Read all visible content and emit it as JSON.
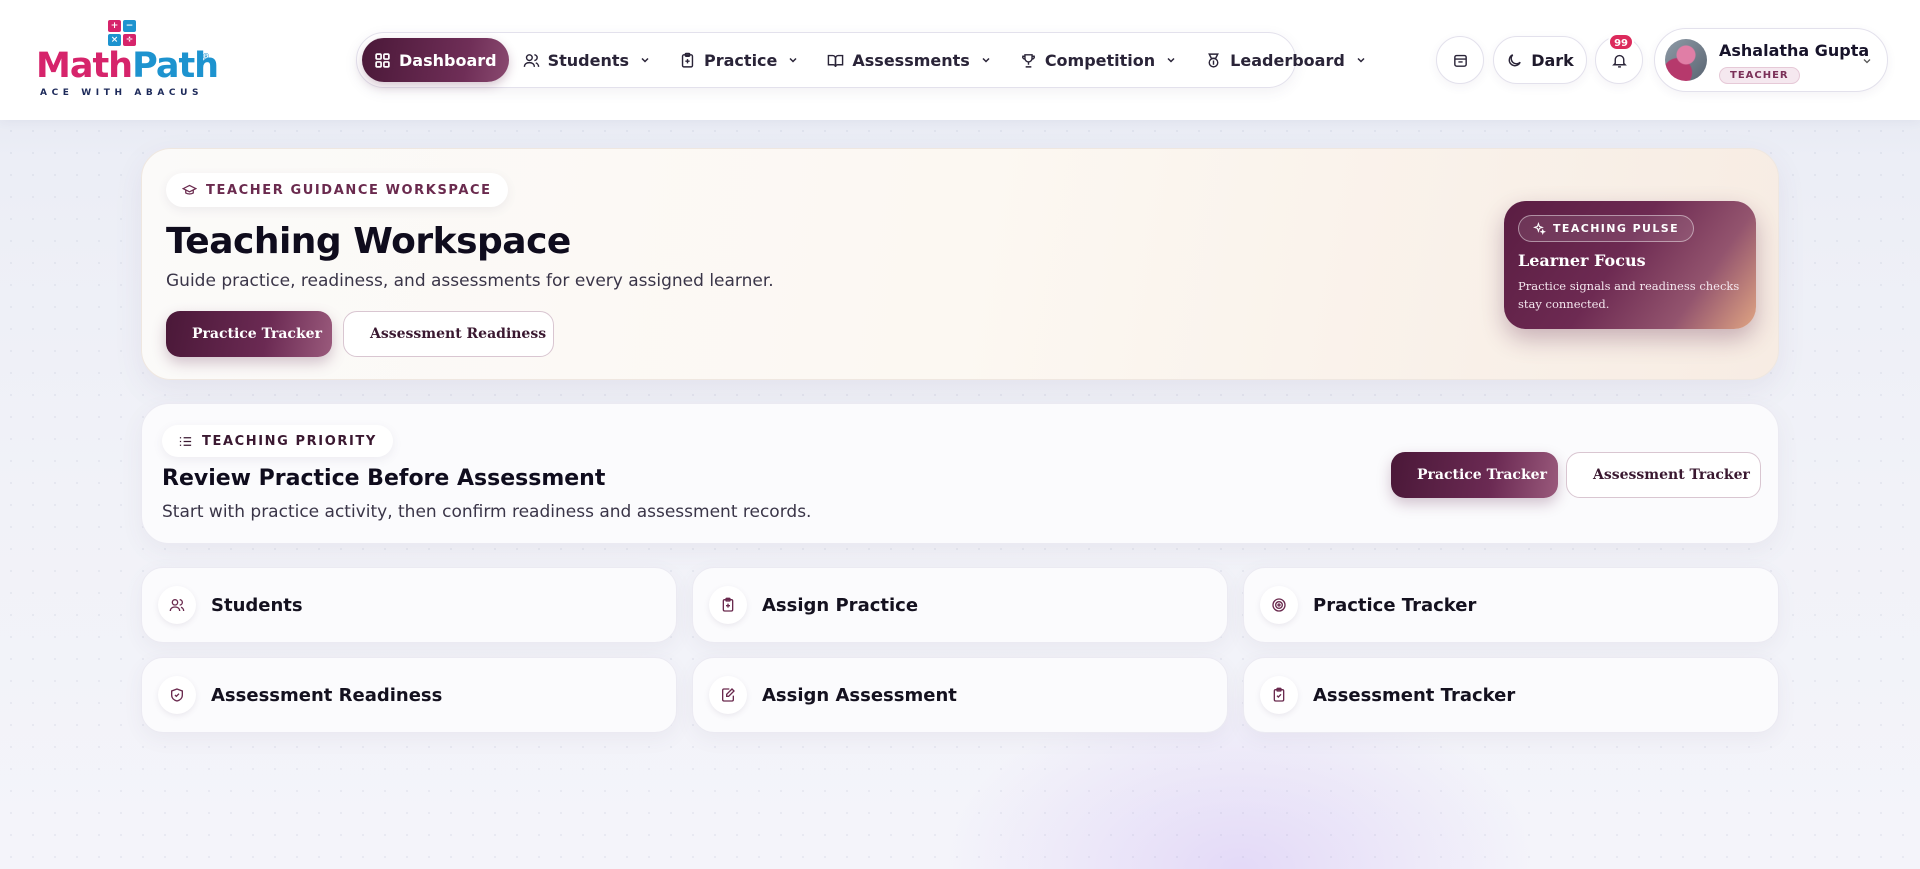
{
  "brand": {
    "name_part1": "Math",
    "name_part2": "Path",
    "tagline": "ACE WITH ABACUS",
    "colors": {
      "pink": "#d6246b",
      "blue": "#1d93cf",
      "navy": "#1d2a5a"
    }
  },
  "nav": {
    "items": [
      {
        "label": "Dashboard",
        "icon": "dashboard-grid-icon",
        "active": true
      },
      {
        "label": "Students",
        "icon": "users-icon"
      },
      {
        "label": "Practice",
        "icon": "clipboard-plus-icon"
      },
      {
        "label": "Assessments",
        "icon": "open-book-icon"
      },
      {
        "label": "Competition",
        "icon": "trophy-icon"
      },
      {
        "label": "Leaderboard",
        "icon": "award-medal-icon"
      }
    ]
  },
  "header": {
    "theme_label": "Dark",
    "notification_count": "99",
    "user_name": "Ashalatha Gupta",
    "user_role": "TEACHER"
  },
  "hero": {
    "eyebrow": "TEACHER GUIDANCE WORKSPACE",
    "title": "Teaching Workspace",
    "subtitle": "Guide practice, readiness, and assessments for every assigned learner.",
    "primary_button": "Practice Tracker",
    "secondary_button": "Assessment Readiness",
    "pulse": {
      "eyebrow": "TEACHING PULSE",
      "title": "Learner Focus",
      "description": "Practice signals and readiness checks stay connected."
    }
  },
  "priority": {
    "eyebrow": "TEACHING PRIORITY",
    "title": "Review Practice Before Assessment",
    "subtitle": "Start with practice activity, then confirm readiness and assessment records.",
    "primary_button": "Practice Tracker",
    "secondary_button": "Assessment Tracker"
  },
  "quick_links": [
    {
      "label": "Students",
      "icon": "users-icon"
    },
    {
      "label": "Assign Practice",
      "icon": "clipboard-plus-icon"
    },
    {
      "label": "Practice Tracker",
      "icon": "target-icon"
    },
    {
      "label": "Assessment Readiness",
      "icon": "shield-check-icon"
    },
    {
      "label": "Assign Assessment",
      "icon": "edit-document-icon"
    },
    {
      "label": "Assessment Tracker",
      "icon": "clipboard-check-icon"
    }
  ],
  "accent": {
    "plum_dark": "#4a1838",
    "plum": "#6f2e57",
    "peach": "#e0a583"
  }
}
